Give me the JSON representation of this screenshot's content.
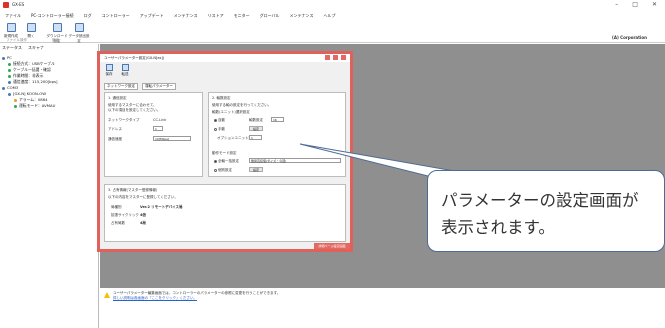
{
  "window": {
    "title": "GX-ES",
    "controls": [
      "–",
      "□",
      "✕"
    ]
  },
  "menu": [
    "ファイル",
    "PC-コントローラー接続",
    "ログ",
    "コントローラー",
    "アップデート",
    "メンテナンス",
    "リストア",
    "モニター",
    "グローバル",
    "メンテナンス",
    "ヘルプ"
  ],
  "ribbon": {
    "buttons": [
      "新規作成",
      "開く",
      "ダウンロード設定",
      "データ読出設定"
    ],
    "groups": [
      "ファイル操作",
      "設定"
    ],
    "brand": "(A) Corporation"
  },
  "sidebar": {
    "tabs": [
      "ステータス",
      "スキャナ"
    ],
    "tree": [
      {
        "text": "PC",
        "color": "#4a78b5"
      },
      {
        "text": "接続方式：USBケーブル",
        "color": "#2fa84f"
      },
      {
        "text": "ケーブル一括選・確認",
        "color": "#2fa84f"
      },
      {
        "text": "作業時間：非表示",
        "color": "#2fa84f"
      },
      {
        "text": "通信速度：115,200[bps]",
        "color": "#4a78b5"
      },
      {
        "text": "COM3",
        "color": "#4a78b5"
      },
      {
        "text": "[GX-N] KOON-OW",
        "color": "#4a78b5"
      },
      {
        "text": "アラーム：0864",
        "color": "#e0a020"
      },
      {
        "text": "運転モード：AVMAU",
        "color": "#2fa84f"
      }
    ]
  },
  "dialog": {
    "title": "ユーザーパラメーター設定(GX-N[ex])",
    "toolbar": [
      "保存",
      "転送"
    ],
    "tabs": [
      "ネットワーク設定",
      "運転パラメーター"
    ],
    "section1": {
      "header": "1. 通信設定",
      "desc1": "使用するマスターに合わせて、",
      "desc2": "以下の項目を設定してください。",
      "network_type_label": "ネットワークタイプ",
      "network_type_value": "CC-Link",
      "address_label": "アドレス",
      "address_value": "1",
      "speed_label": "通信速度",
      "speed_value": "10[Mbps]"
    },
    "section2": {
      "header": "2. 軸数設定",
      "desc": "使用する軸の設定を行ってください。",
      "sub1": "軸数(ユニット)選択設定",
      "auto": "自動",
      "axis_label": "軸数設定",
      "axis_value": "16",
      "manual": "手動",
      "set_btn": "設定",
      "option_label": "オプションユニット数",
      "option_value": "1",
      "sub2": "動作モード設定",
      "mode_all": "全軸一括設定",
      "mode_value": "簡易直接値(ダイズ・今回)",
      "mode_each": "個別設定",
      "set_btn2": "設定"
    },
    "section3": {
      "header": "3. 占有情報(マスター登録情報)",
      "desc": "以下の内容をマスターに登録してください。",
      "rows": [
        {
          "label": "局種別",
          "value": "Ver.2 リモートデバイス局"
        },
        {
          "label": "拡張サイクリック",
          "value": "4倍"
        },
        {
          "label": "占有局数",
          "value": "4局"
        }
      ]
    },
    "footer_button": "詳細ページ設定画面"
  },
  "status": {
    "line1": "ユーザーパラメーター編集画面では、コントローラーのパラメーターの参照に変更を行うことができます。",
    "line2": "詳しい説明は各画面の「ここをクリック」ください。"
  },
  "callout": {
    "line1": "パラメーターの設定画面が",
    "line2": "表示されます。"
  }
}
